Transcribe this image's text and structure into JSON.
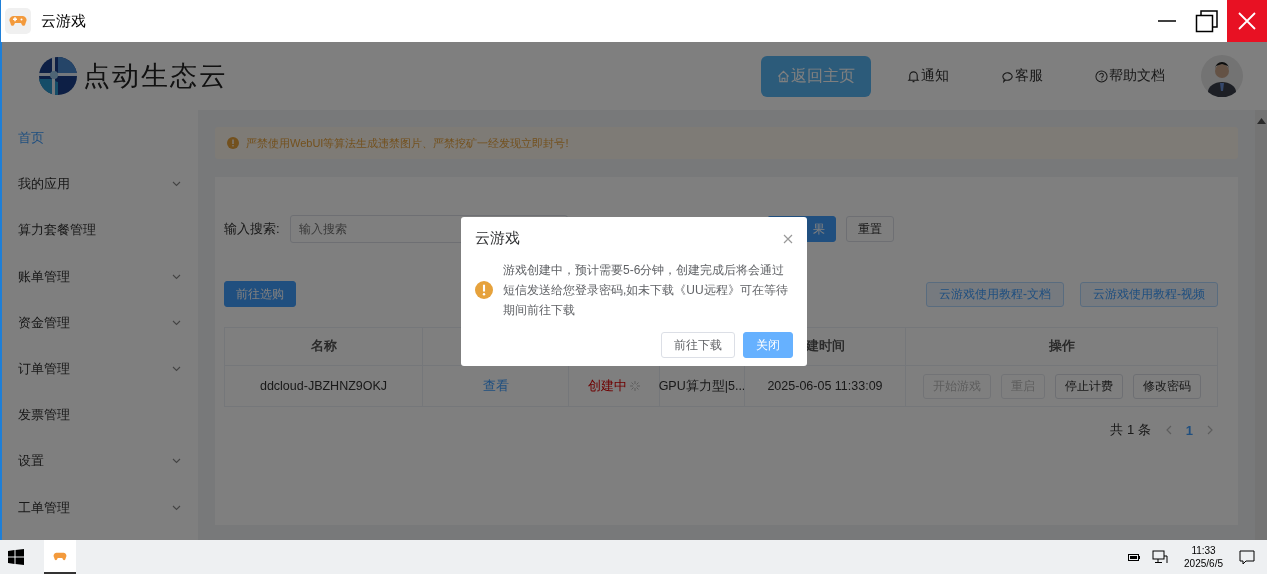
{
  "window": {
    "title": "云游戏"
  },
  "brand": {
    "name": "点动生态云"
  },
  "nav": [
    {
      "label": "返回主页",
      "selected": true
    },
    {
      "label": "通知",
      "selected": false
    },
    {
      "label": "客服",
      "selected": false
    },
    {
      "label": "帮助文档",
      "selected": false
    }
  ],
  "sidebar": {
    "items": [
      {
        "label": "首页",
        "kind": "link",
        "selected": true
      },
      {
        "label": "我的应用",
        "kind": "submenu",
        "selected": false
      },
      {
        "label": "算力套餐管理",
        "kind": "link",
        "selected": false
      },
      {
        "label": "账单管理",
        "kind": "submenu",
        "selected": false
      },
      {
        "label": "资金管理",
        "kind": "submenu",
        "selected": false
      },
      {
        "label": "订单管理",
        "kind": "submenu",
        "selected": false
      },
      {
        "label": "发票管理",
        "kind": "link",
        "selected": false
      },
      {
        "label": "设置",
        "kind": "submenu",
        "selected": false
      },
      {
        "label": "工单管理",
        "kind": "submenu",
        "selected": false
      }
    ]
  },
  "notice": {
    "text": "严禁使用WebUI等算法生成违禁图片、严禁挖矿一经发现立即封号!"
  },
  "search": {
    "label": "输入搜索:",
    "placeholder": "输入搜索",
    "buttons": [
      {
        "label": "果",
        "kind": "primary"
      },
      {
        "label": "重置",
        "kind": "default"
      }
    ]
  },
  "toolbar": {
    "buy_button": "前往选购",
    "tutorial_buttons": [
      "云游戏使用教程-文档",
      "云游戏使用教程-视频"
    ]
  },
  "table": {
    "columns": [
      "名称",
      "",
      "",
      "",
      "建时间",
      "操作"
    ],
    "rows": [
      {
        "name": "ddcloud-JBZHNZ9OKJ",
        "link": "查看",
        "status": "创建中",
        "spec": "GPU算力型|5...",
        "created": "2025-06-05 11:33:09",
        "actions": [
          {
            "label": "开始游戏",
            "disabled": true
          },
          {
            "label": "重启",
            "disabled": true
          },
          {
            "label": "停止计费",
            "disabled": false
          },
          {
            "label": "修改密码",
            "disabled": false
          }
        ]
      }
    ]
  },
  "pagination": {
    "total": "共 1 条",
    "pages": [
      {
        "label": "1",
        "selected": true
      }
    ]
  },
  "dialog": {
    "title": "云游戏",
    "message": "游戏创建中，预计需要5-6分钟，创建完成后将会通过短信发送给您登录密码,如未下载《UU远程》可在等待期间前往下载",
    "buttons": [
      {
        "label": "前往下载",
        "kind": "default"
      },
      {
        "label": "关闭",
        "kind": "primary"
      }
    ]
  },
  "taskbar": {
    "time": "11:33",
    "date": "2025/6/5"
  }
}
